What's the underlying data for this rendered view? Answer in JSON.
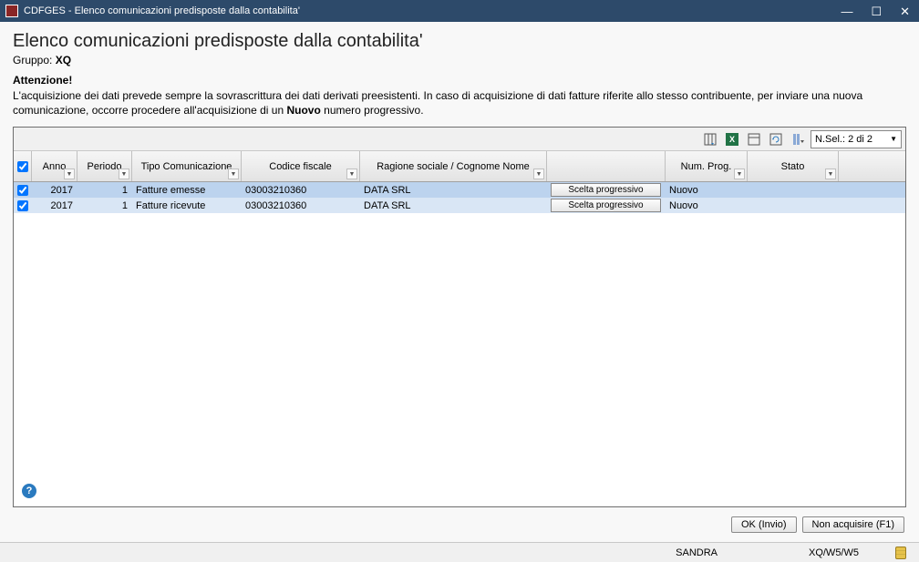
{
  "window": {
    "title": "CDFGES - Elenco comunicazioni predisposte dalla contabilita'"
  },
  "page": {
    "title": "Elenco comunicazioni predisposte dalla contabilita'",
    "group_label": "Gruppo:",
    "group_value": "XQ"
  },
  "attention": {
    "head": "Attenzione!",
    "body_a": "L'acquisizione dei dati prevede sempre la sovrascrittura dei dati derivati preesistenti. In caso di acquisizione di dati fatture riferite allo stesso contribuente, per inviare una nuova comunicazione, occorre procedere all'acquisizione di un ",
    "body_bold": "Nuovo",
    "body_b": " numero progressivo."
  },
  "toolbar": {
    "sel_label": "N.Sel.: 2 di 2"
  },
  "grid": {
    "headers": {
      "anno": "Anno",
      "periodo": "Periodo",
      "tipo": "Tipo Comunicazione",
      "cf": "Codice fiscale",
      "ragione": "Ragione sociale / Cognome Nome",
      "scelta": "",
      "numprog": "Num. Prog.",
      "stato": "Stato"
    },
    "rows": [
      {
        "checked": true,
        "anno": "2017",
        "periodo": "1",
        "tipo": "Fatture emesse",
        "cf": "03003210360",
        "ragione": "DATA SRL",
        "scelta": "Scelta progressivo",
        "numprog": "Nuovo",
        "stato": ""
      },
      {
        "checked": true,
        "anno": "2017",
        "periodo": "1",
        "tipo": "Fatture ricevute",
        "cf": "03003210360",
        "ragione": "DATA SRL",
        "scelta": "Scelta progressivo",
        "numprog": "Nuovo",
        "stato": ""
      }
    ]
  },
  "buttons": {
    "ok": "OK (Invio)",
    "cancel": "Non acquisire (F1)"
  },
  "statusbar": {
    "user": "SANDRA",
    "path": "XQ/W5/W5"
  }
}
